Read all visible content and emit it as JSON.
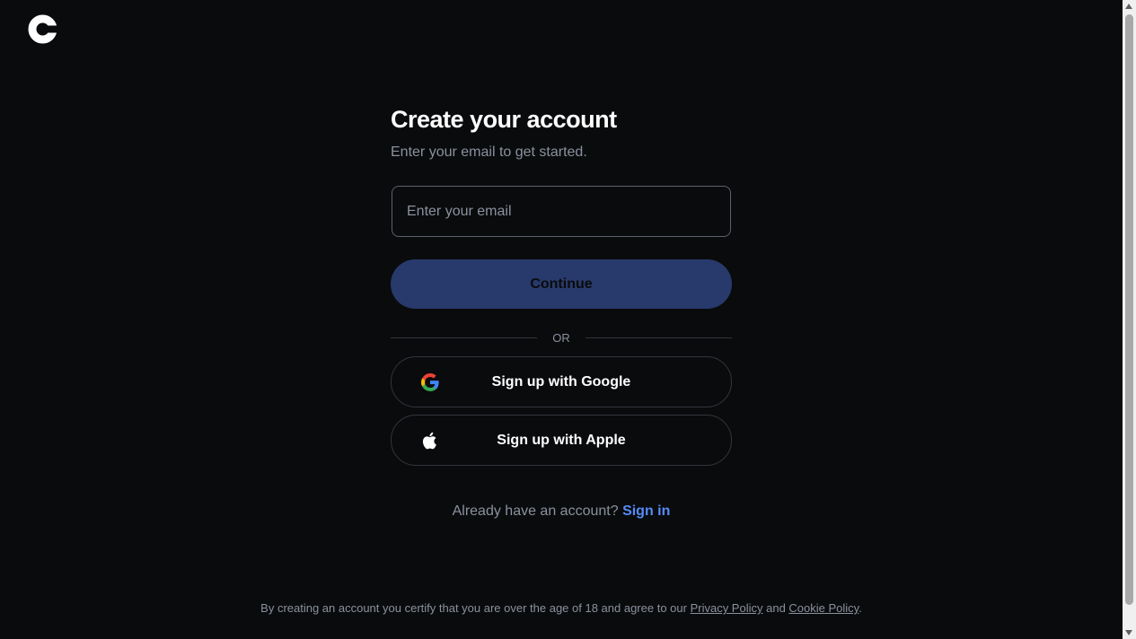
{
  "colors": {
    "background": "#0a0b0d",
    "primary_button_disabled": "#283a6b",
    "link": "#578bfa",
    "muted_text": "#8a919e",
    "border": "#32353d"
  },
  "logo": {
    "icon": "coinbase-logo-icon"
  },
  "form": {
    "title": "Create your account",
    "subtitle": "Enter your email to get started.",
    "email_placeholder": "Enter your email",
    "email_value": "",
    "continue_label": "Continue",
    "divider_label": "OR",
    "google_label": "Sign up with Google",
    "google_icon": "google-icon",
    "apple_label": "Sign up with Apple",
    "apple_icon": "apple-icon",
    "signin_prompt": "Already have an account?",
    "signin_link": "Sign in"
  },
  "footer": {
    "text_before": "By creating an account you certify that you are over the age of 18 and agree to our ",
    "privacy_link": "Privacy Policy",
    "text_middle": " and ",
    "cookie_link": "Cookie Policy",
    "text_after": "."
  }
}
